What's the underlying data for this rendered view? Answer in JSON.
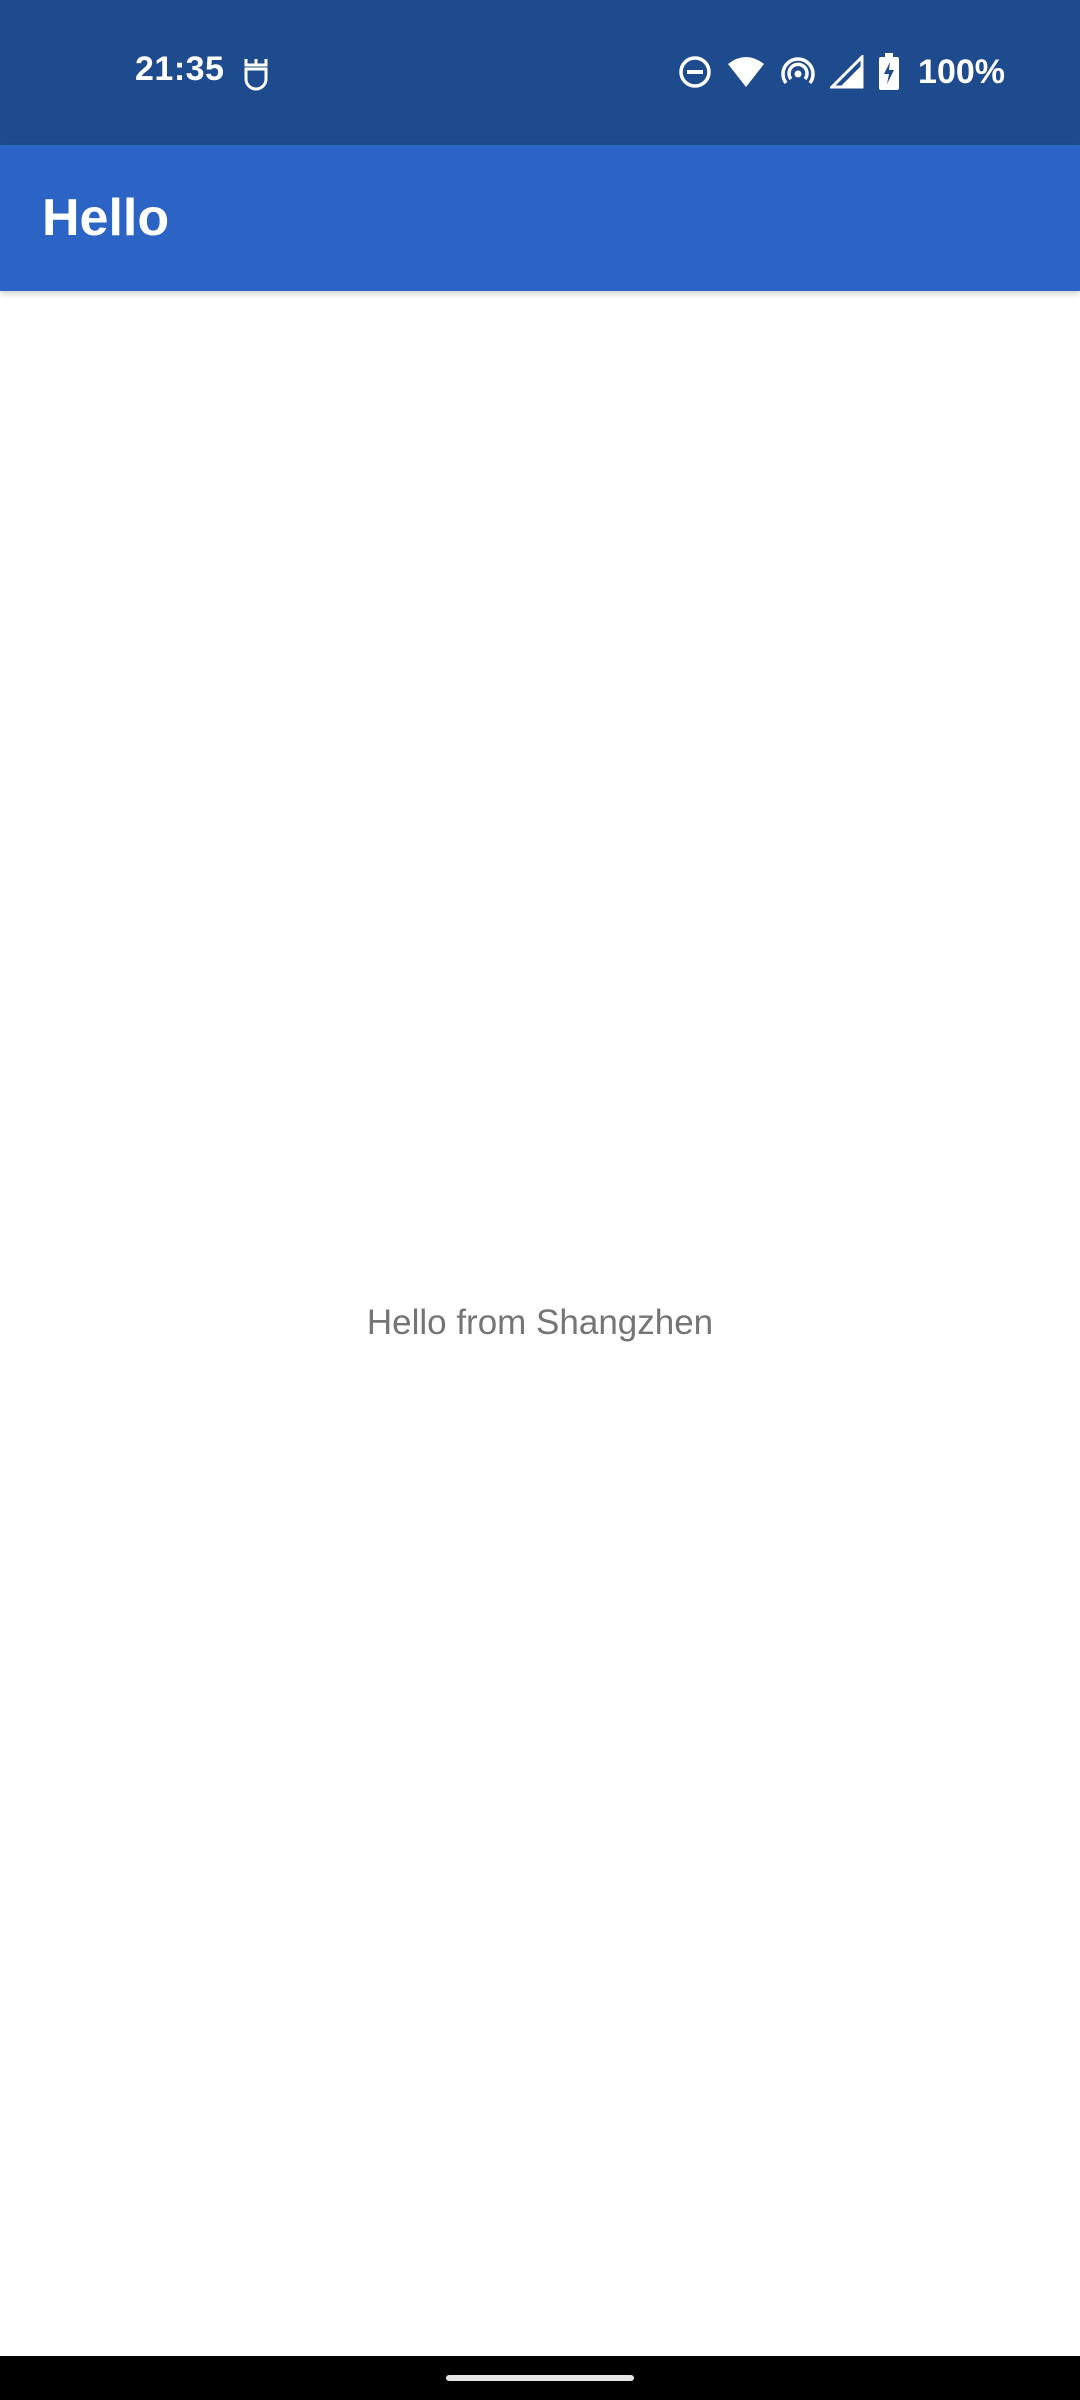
{
  "status_bar": {
    "time": "21:35",
    "left_icons": [
      "notification-icon"
    ],
    "right_icons": [
      "do-not-disturb-icon",
      "wifi-icon",
      "hotspot-icon",
      "cellular-signal-icon",
      "battery-charging-icon"
    ],
    "battery": "100%",
    "background_color": "#1e4a8e"
  },
  "app_bar": {
    "title": "Hello",
    "background_color": "#2c64c6"
  },
  "main": {
    "message": "Hello from Shangzhen"
  }
}
